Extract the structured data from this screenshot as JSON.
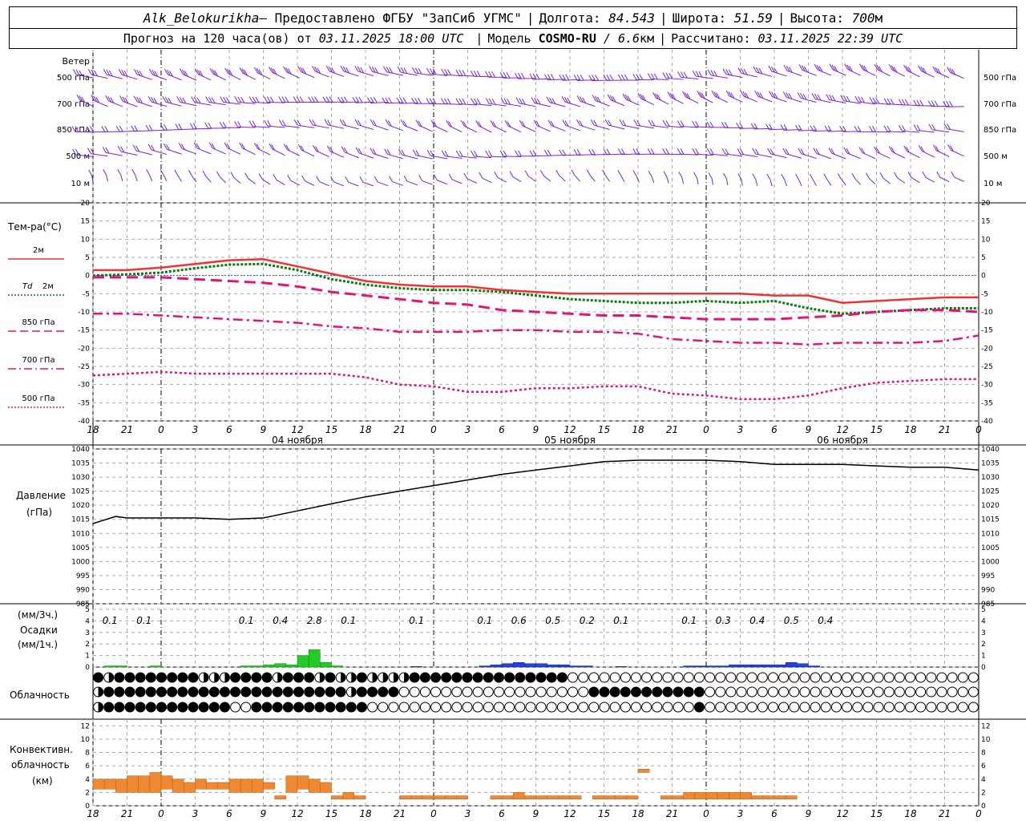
{
  "header": {
    "station": "Alk_Belokurikha",
    "provider": " – Предоставлено ФГБУ \"ЗапСиб УГМС\"",
    "lon_label": "Долгота:",
    "lon_value": "84.543",
    "lat_label": "Широта:",
    "lat_value": "51.59",
    "alt_label": "Высота:",
    "alt_value": "700",
    "alt_unit": "м",
    "forecast_label": "Прогноз на 120 часа(ов) от",
    "forecast_time": "03.11.2025 18:00 UTC",
    "model_label": "Модель",
    "model_name": "COSMO-RU",
    "model_res": "/ 6.6",
    "model_res_unit": "км",
    "computed_label": "Рассчитано:",
    "computed_time": "03.11.2025 22:39 UTC"
  },
  "wind_panel": {
    "title": "Ветер",
    "levels": [
      "500 гПа",
      "700 гПа",
      "850 гПа",
      "500 м",
      "10 м"
    ],
    "color": "#7b22d6"
  },
  "time_axis": {
    "hour_labels": [
      "18",
      "21",
      "0",
      "3",
      "6",
      "9",
      "12",
      "15",
      "18",
      "21",
      "0",
      "3",
      "6",
      "9",
      "12",
      "15",
      "18",
      "21",
      "0",
      "3",
      "6",
      "9",
      "12",
      "15",
      "18",
      "21",
      "0"
    ],
    "date_labels": [
      {
        "hour": 18,
        "label": "04 ноября"
      },
      {
        "hour": 42,
        "label": "05 ноября"
      },
      {
        "hour": 66,
        "label": "06 ноября"
      }
    ]
  },
  "temperature_panel": {
    "title": "Тем-ра(°С)",
    "ticks": [
      "20",
      "15",
      "10",
      "5",
      "0",
      "-5",
      "-10",
      "-15",
      "-20",
      "-25",
      "-30",
      "-35",
      "-40"
    ],
    "legend": [
      {
        "label": "2м",
        "color": "#ee3333",
        "style": "solid"
      },
      {
        "label": "2м",
        "prefix": "Td",
        "color": "#117711",
        "style": "dotted"
      },
      {
        "label": "850 гПа",
        "color": "#e0157a",
        "style": "dashed"
      },
      {
        "label": "700 гПа",
        "color": "#e0157a",
        "style": "dashdot"
      },
      {
        "label": "500 гПа",
        "color": "#e0157a",
        "style": "dotted"
      }
    ]
  },
  "pressure_panel": {
    "title": "Давление",
    "unit": "(гПа)",
    "ticks": [
      "1040",
      "1035",
      "1030",
      "1025",
      "1020",
      "1015",
      "1010",
      "1005",
      "1000",
      "995",
      "990",
      "985"
    ]
  },
  "precip_panel": {
    "unit_3h": "(мм/3ч.)",
    "title": "Осадки",
    "unit_1h": "(мм/1ч.)",
    "ticks": [
      "5",
      "4",
      "3",
      "2",
      "1",
      "0"
    ],
    "labels_3h": [
      {
        "hour": 1.5,
        "text": "0.1"
      },
      {
        "hour": 4.5,
        "text": "0.1"
      },
      {
        "hour": 13.5,
        "text": "0.1"
      },
      {
        "hour": 16.5,
        "text": "0.4"
      },
      {
        "hour": 19.5,
        "text": "2.8"
      },
      {
        "hour": 22.5,
        "text": "0.1"
      },
      {
        "hour": 28.5,
        "text": "0.1"
      },
      {
        "hour": 34.5,
        "text": "0.1"
      },
      {
        "hour": 37.5,
        "text": "0.6"
      },
      {
        "hour": 40.5,
        "text": "0.5"
      },
      {
        "hour": 43.5,
        "text": "0.2"
      },
      {
        "hour": 46.5,
        "text": "0.1"
      },
      {
        "hour": 52.5,
        "text": "0.1"
      },
      {
        "hour": 55.5,
        "text": "0.3"
      },
      {
        "hour": 58.5,
        "text": "0.4"
      },
      {
        "hour": 61.5,
        "text": "0.5"
      },
      {
        "hour": 64.5,
        "text": "0.4"
      }
    ]
  },
  "cloud_panel": {
    "title": "Облачность"
  },
  "conv_panel": {
    "title_1": "Конвективн.",
    "title_2": "облачность",
    "unit": "(км)",
    "ticks": [
      "12",
      "10",
      "8",
      "6",
      "4",
      "2",
      "0"
    ]
  },
  "colors": {
    "wind": "#7b22d6",
    "t2m": "#ee3333",
    "td2m": "#117711",
    "t_upper": "#e0157a",
    "pressure": "#000000",
    "rain": "#22cc22",
    "snow": "#2244dd",
    "convective": "#ee8833",
    "grid": "#aaaaaa"
  },
  "chart_data": {
    "type": "line",
    "x_unit": "hours since 03.11.2025 18:00 UTC",
    "x_range": [
      0,
      78
    ],
    "series": [
      {
        "name": "2м",
        "points": [
          [
            0,
            1.5
          ],
          [
            3,
            1.5
          ],
          [
            6,
            2.2
          ],
          [
            9,
            3.2
          ],
          [
            12,
            4.2
          ],
          [
            15,
            4.5
          ],
          [
            18,
            2.5
          ],
          [
            21,
            0.5
          ],
          [
            24,
            -1.5
          ],
          [
            27,
            -2.5
          ],
          [
            30,
            -3
          ],
          [
            33,
            -3
          ],
          [
            36,
            -4
          ],
          [
            39,
            -4.5
          ],
          [
            42,
            -5
          ],
          [
            45,
            -5
          ],
          [
            48,
            -5
          ],
          [
            51,
            -5
          ],
          [
            54,
            -5
          ],
          [
            57,
            -5
          ],
          [
            60,
            -5.5
          ],
          [
            63,
            -5.5
          ],
          [
            66,
            -7.5
          ],
          [
            69,
            -7
          ],
          [
            72,
            -6.5
          ],
          [
            75,
            -6
          ],
          [
            78,
            -6
          ]
        ]
      },
      {
        "name": "Td 2м",
        "points": [
          [
            0,
            0
          ],
          [
            3,
            0.3
          ],
          [
            6,
            0.8
          ],
          [
            9,
            2
          ],
          [
            12,
            3
          ],
          [
            15,
            3.2
          ],
          [
            18,
            1.5
          ],
          [
            21,
            -1
          ],
          [
            24,
            -2.5
          ],
          [
            27,
            -3.5
          ],
          [
            30,
            -4
          ],
          [
            33,
            -4
          ],
          [
            36,
            -4.5
          ],
          [
            39,
            -5.5
          ],
          [
            42,
            -6.5
          ],
          [
            45,
            -7
          ],
          [
            48,
            -7.5
          ],
          [
            51,
            -7.5
          ],
          [
            54,
            -7
          ],
          [
            57,
            -7.5
          ],
          [
            60,
            -7
          ],
          [
            63,
            -9
          ],
          [
            66,
            -10.5
          ],
          [
            69,
            -10
          ],
          [
            72,
            -9.5
          ],
          [
            75,
            -9
          ],
          [
            78,
            -9
          ]
        ]
      },
      {
        "name": "850 гПа",
        "points": [
          [
            0,
            -0.5
          ],
          [
            3,
            -0.5
          ],
          [
            6,
            -0.5
          ],
          [
            9,
            -1
          ],
          [
            12,
            -1.5
          ],
          [
            15,
            -2
          ],
          [
            18,
            -3
          ],
          [
            21,
            -4.5
          ],
          [
            24,
            -5.5
          ],
          [
            27,
            -6.5
          ],
          [
            30,
            -7.5
          ],
          [
            33,
            -8
          ],
          [
            36,
            -9.5
          ],
          [
            39,
            -10
          ],
          [
            42,
            -10.5
          ],
          [
            45,
            -11
          ],
          [
            48,
            -11
          ],
          [
            51,
            -11.5
          ],
          [
            54,
            -12
          ],
          [
            57,
            -12
          ],
          [
            60,
            -12
          ],
          [
            63,
            -11.5
          ],
          [
            66,
            -11
          ],
          [
            69,
            -10
          ],
          [
            72,
            -9.5
          ],
          [
            75,
            -9.5
          ],
          [
            78,
            -10
          ]
        ]
      },
      {
        "name": "700 гПа",
        "points": [
          [
            0,
            -10.5
          ],
          [
            3,
            -10.5
          ],
          [
            6,
            -11
          ],
          [
            9,
            -11.5
          ],
          [
            12,
            -12
          ],
          [
            15,
            -12.5
          ],
          [
            18,
            -13
          ],
          [
            21,
            -14
          ],
          [
            24,
            -14.5
          ],
          [
            27,
            -15.5
          ],
          [
            30,
            -15.5
          ],
          [
            33,
            -15.5
          ],
          [
            36,
            -15
          ],
          [
            39,
            -15
          ],
          [
            42,
            -15.5
          ],
          [
            45,
            -15.5
          ],
          [
            48,
            -16
          ],
          [
            51,
            -17.5
          ],
          [
            54,
            -18
          ],
          [
            57,
            -18.5
          ],
          [
            60,
            -18.5
          ],
          [
            63,
            -19
          ],
          [
            66,
            -18.5
          ],
          [
            69,
            -18.5
          ],
          [
            72,
            -18.5
          ],
          [
            75,
            -18
          ],
          [
            78,
            -16.5
          ]
        ]
      },
      {
        "name": "500 гПа",
        "points": [
          [
            0,
            -27.5
          ],
          [
            3,
            -27
          ],
          [
            6,
            -26.5
          ],
          [
            9,
            -27
          ],
          [
            12,
            -27
          ],
          [
            15,
            -27
          ],
          [
            18,
            -27
          ],
          [
            21,
            -27
          ],
          [
            24,
            -28
          ],
          [
            27,
            -30
          ],
          [
            30,
            -30.5
          ],
          [
            33,
            -32
          ],
          [
            36,
            -32
          ],
          [
            39,
            -31
          ],
          [
            42,
            -31
          ],
          [
            45,
            -30.5
          ],
          [
            48,
            -30.5
          ],
          [
            51,
            -32.5
          ],
          [
            54,
            -33
          ],
          [
            57,
            -34
          ],
          [
            60,
            -34
          ],
          [
            63,
            -33
          ],
          [
            66,
            -31
          ],
          [
            69,
            -29.5
          ],
          [
            72,
            -29
          ],
          [
            75,
            -28.5
          ],
          [
            78,
            -28.5
          ]
        ]
      },
      {
        "name": "Давление",
        "points": [
          [
            0,
            1013.5
          ],
          [
            2,
            1016
          ],
          [
            3,
            1015.5
          ],
          [
            6,
            1015.5
          ],
          [
            9,
            1015.5
          ],
          [
            12,
            1015
          ],
          [
            15,
            1015.5
          ],
          [
            18,
            1018
          ],
          [
            21,
            1020.5
          ],
          [
            24,
            1023
          ],
          [
            27,
            1025
          ],
          [
            30,
            1027
          ],
          [
            33,
            1029
          ],
          [
            36,
            1031
          ],
          [
            39,
            1032.5
          ],
          [
            42,
            1034
          ],
          [
            45,
            1035.5
          ],
          [
            48,
            1036
          ],
          [
            51,
            1036
          ],
          [
            54,
            1036
          ],
          [
            57,
            1035.5
          ],
          [
            60,
            1034.5
          ],
          [
            63,
            1034.5
          ],
          [
            66,
            1034.5
          ],
          [
            69,
            1034
          ],
          [
            72,
            1033.5
          ],
          [
            75,
            1033.5
          ],
          [
            78,
            1032.5
          ]
        ]
      }
    ],
    "precip_1h": {
      "rain": [
        [
          1,
          0.1
        ],
        [
          2,
          0.1
        ],
        [
          5,
          0.1
        ],
        [
          13,
          0.1
        ],
        [
          14,
          0.1
        ],
        [
          15,
          0.2
        ],
        [
          16,
          0.3
        ],
        [
          17,
          0.2
        ],
        [
          18,
          1.0
        ],
        [
          19,
          1.5
        ],
        [
          20,
          0.4
        ],
        [
          21,
          0.1
        ]
      ],
      "snow": [
        [
          28,
          0.05
        ],
        [
          34,
          0.1
        ],
        [
          35,
          0.2
        ],
        [
          36,
          0.3
        ],
        [
          37,
          0.4
        ],
        [
          38,
          0.3
        ],
        [
          39,
          0.3
        ],
        [
          40,
          0.2
        ],
        [
          41,
          0.2
        ],
        [
          42,
          0.1
        ],
        [
          43,
          0.1
        ],
        [
          46,
          0.05
        ],
        [
          52,
          0.1
        ],
        [
          53,
          0.1
        ],
        [
          54,
          0.1
        ],
        [
          55,
          0.1
        ],
        [
          56,
          0.2
        ],
        [
          57,
          0.2
        ],
        [
          58,
          0.2
        ],
        [
          59,
          0.2
        ],
        [
          60,
          0.2
        ],
        [
          61,
          0.4
        ],
        [
          62,
          0.3
        ],
        [
          63,
          0.1
        ]
      ]
    },
    "convective_km": [
      [
        0,
        2.5,
        4
      ],
      [
        1,
        2.5,
        4
      ],
      [
        2,
        2,
        4
      ],
      [
        3,
        2,
        4.5
      ],
      [
        4,
        2,
        4.5
      ],
      [
        5,
        2,
        5
      ],
      [
        6,
        2.5,
        4.5
      ],
      [
        7,
        2,
        4
      ],
      [
        8,
        2,
        3.5
      ],
      [
        9,
        2.5,
        4
      ],
      [
        10,
        2.5,
        3.5
      ],
      [
        11,
        2.5,
        3.5
      ],
      [
        12,
        2,
        4
      ],
      [
        13,
        2,
        4
      ],
      [
        14,
        2,
        4
      ],
      [
        15,
        2.5,
        3.5
      ],
      [
        16,
        1,
        1.5
      ],
      [
        17,
        2,
        4.5
      ],
      [
        18,
        2.5,
        4.5
      ],
      [
        19,
        2,
        4
      ],
      [
        20,
        2,
        3.5
      ],
      [
        21,
        1,
        1.5
      ],
      [
        22,
        1,
        2
      ],
      [
        23,
        1,
        1.5
      ],
      [
        27,
        1,
        1.5
      ],
      [
        28,
        1,
        1.5
      ],
      [
        29,
        1,
        1.5
      ],
      [
        30,
        1,
        1.5
      ],
      [
        31,
        1,
        1.5
      ],
      [
        32,
        1,
        1.5
      ],
      [
        35,
        1,
        1.5
      ],
      [
        36,
        1,
        1.5
      ],
      [
        37,
        1,
        2
      ],
      [
        38,
        1,
        1.5
      ],
      [
        39,
        1,
        1.5
      ],
      [
        40,
        1,
        1.5
      ],
      [
        41,
        1,
        1.5
      ],
      [
        42,
        1,
        1.5
      ],
      [
        44,
        1,
        1.5
      ],
      [
        45,
        1,
        1.5
      ],
      [
        46,
        1,
        1.5
      ],
      [
        47,
        1,
        1.5
      ],
      [
        48,
        5,
        5.5
      ],
      [
        50,
        1,
        1.5
      ],
      [
        51,
        1,
        1.5
      ],
      [
        52,
        1,
        2
      ],
      [
        53,
        1,
        2
      ],
      [
        54,
        1,
        2
      ],
      [
        55,
        1,
        2
      ],
      [
        56,
        1,
        2
      ],
      [
        57,
        1,
        2
      ],
      [
        58,
        1,
        1.5
      ],
      [
        59,
        1,
        1.5
      ],
      [
        60,
        1,
        1.5
      ],
      [
        61,
        1,
        1.5
      ]
    ],
    "cloud_rows": {
      "high": "313333333311133331333131131111333333333333333000000000000000000000000000000000000000",
      "mid": "133333333333333333333333133330000000000000000003333333333300000000000000000000000000",
      "low": "133333333333300333333333330000000000000000000000000000000300000000000000000000000000"
    },
    "temp_ylim": [
      -40,
      20
    ],
    "pressure_ylim": [
      985,
      1040
    ],
    "precip_ylim": [
      0,
      5
    ],
    "conv_ylim": [
      0,
      13
    ]
  }
}
